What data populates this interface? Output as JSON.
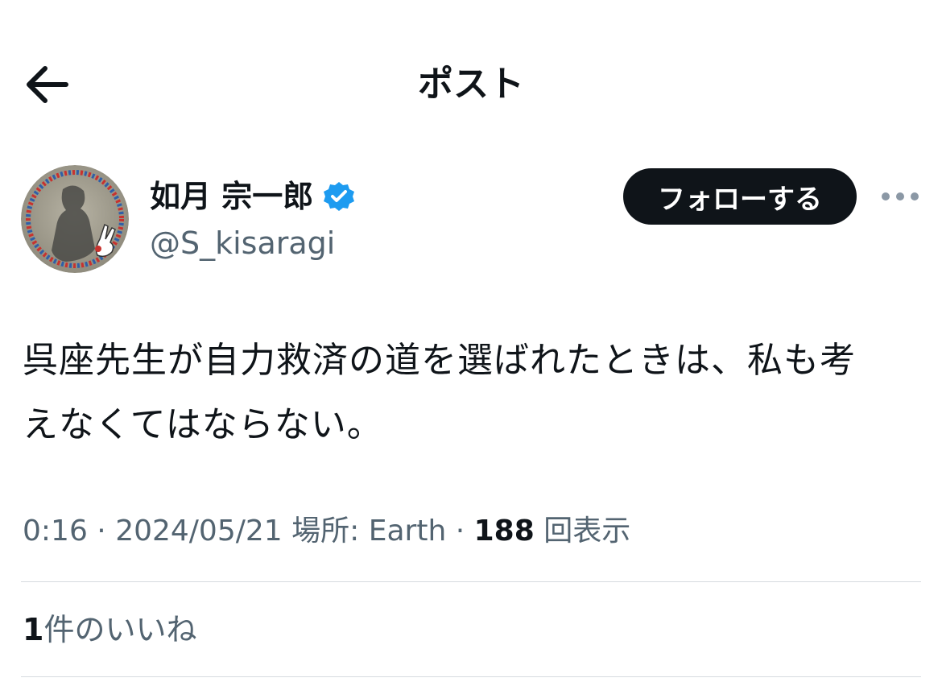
{
  "header": {
    "back_icon": "arrow-left-icon",
    "title": "ポスト"
  },
  "author": {
    "display_name": "如月 宗一郎",
    "handle": "@S_kisaragi",
    "verified_icon": "verified-badge-icon",
    "follow_label": "フォローする",
    "more_icon": "more-horizontal-icon"
  },
  "post": {
    "text_lines": [
      "呉座先生が自力救済の道を選ばれたときは、私も考",
      "えなくてはならない。"
    ]
  },
  "meta": {
    "time": "0:16",
    "sep1": " · ",
    "date": "2024/05/21",
    "location_label": " 場所: ",
    "location": "Earth",
    "sep2": " · ",
    "views_count": "188",
    "views_label": " 回表示"
  },
  "likes": {
    "count": "1",
    "label": "件のいいね"
  },
  "colors": {
    "text_primary": "#0f1419",
    "text_secondary": "#536471",
    "verified_blue": "#1d9bf0",
    "divider": "#d6dbdf"
  }
}
